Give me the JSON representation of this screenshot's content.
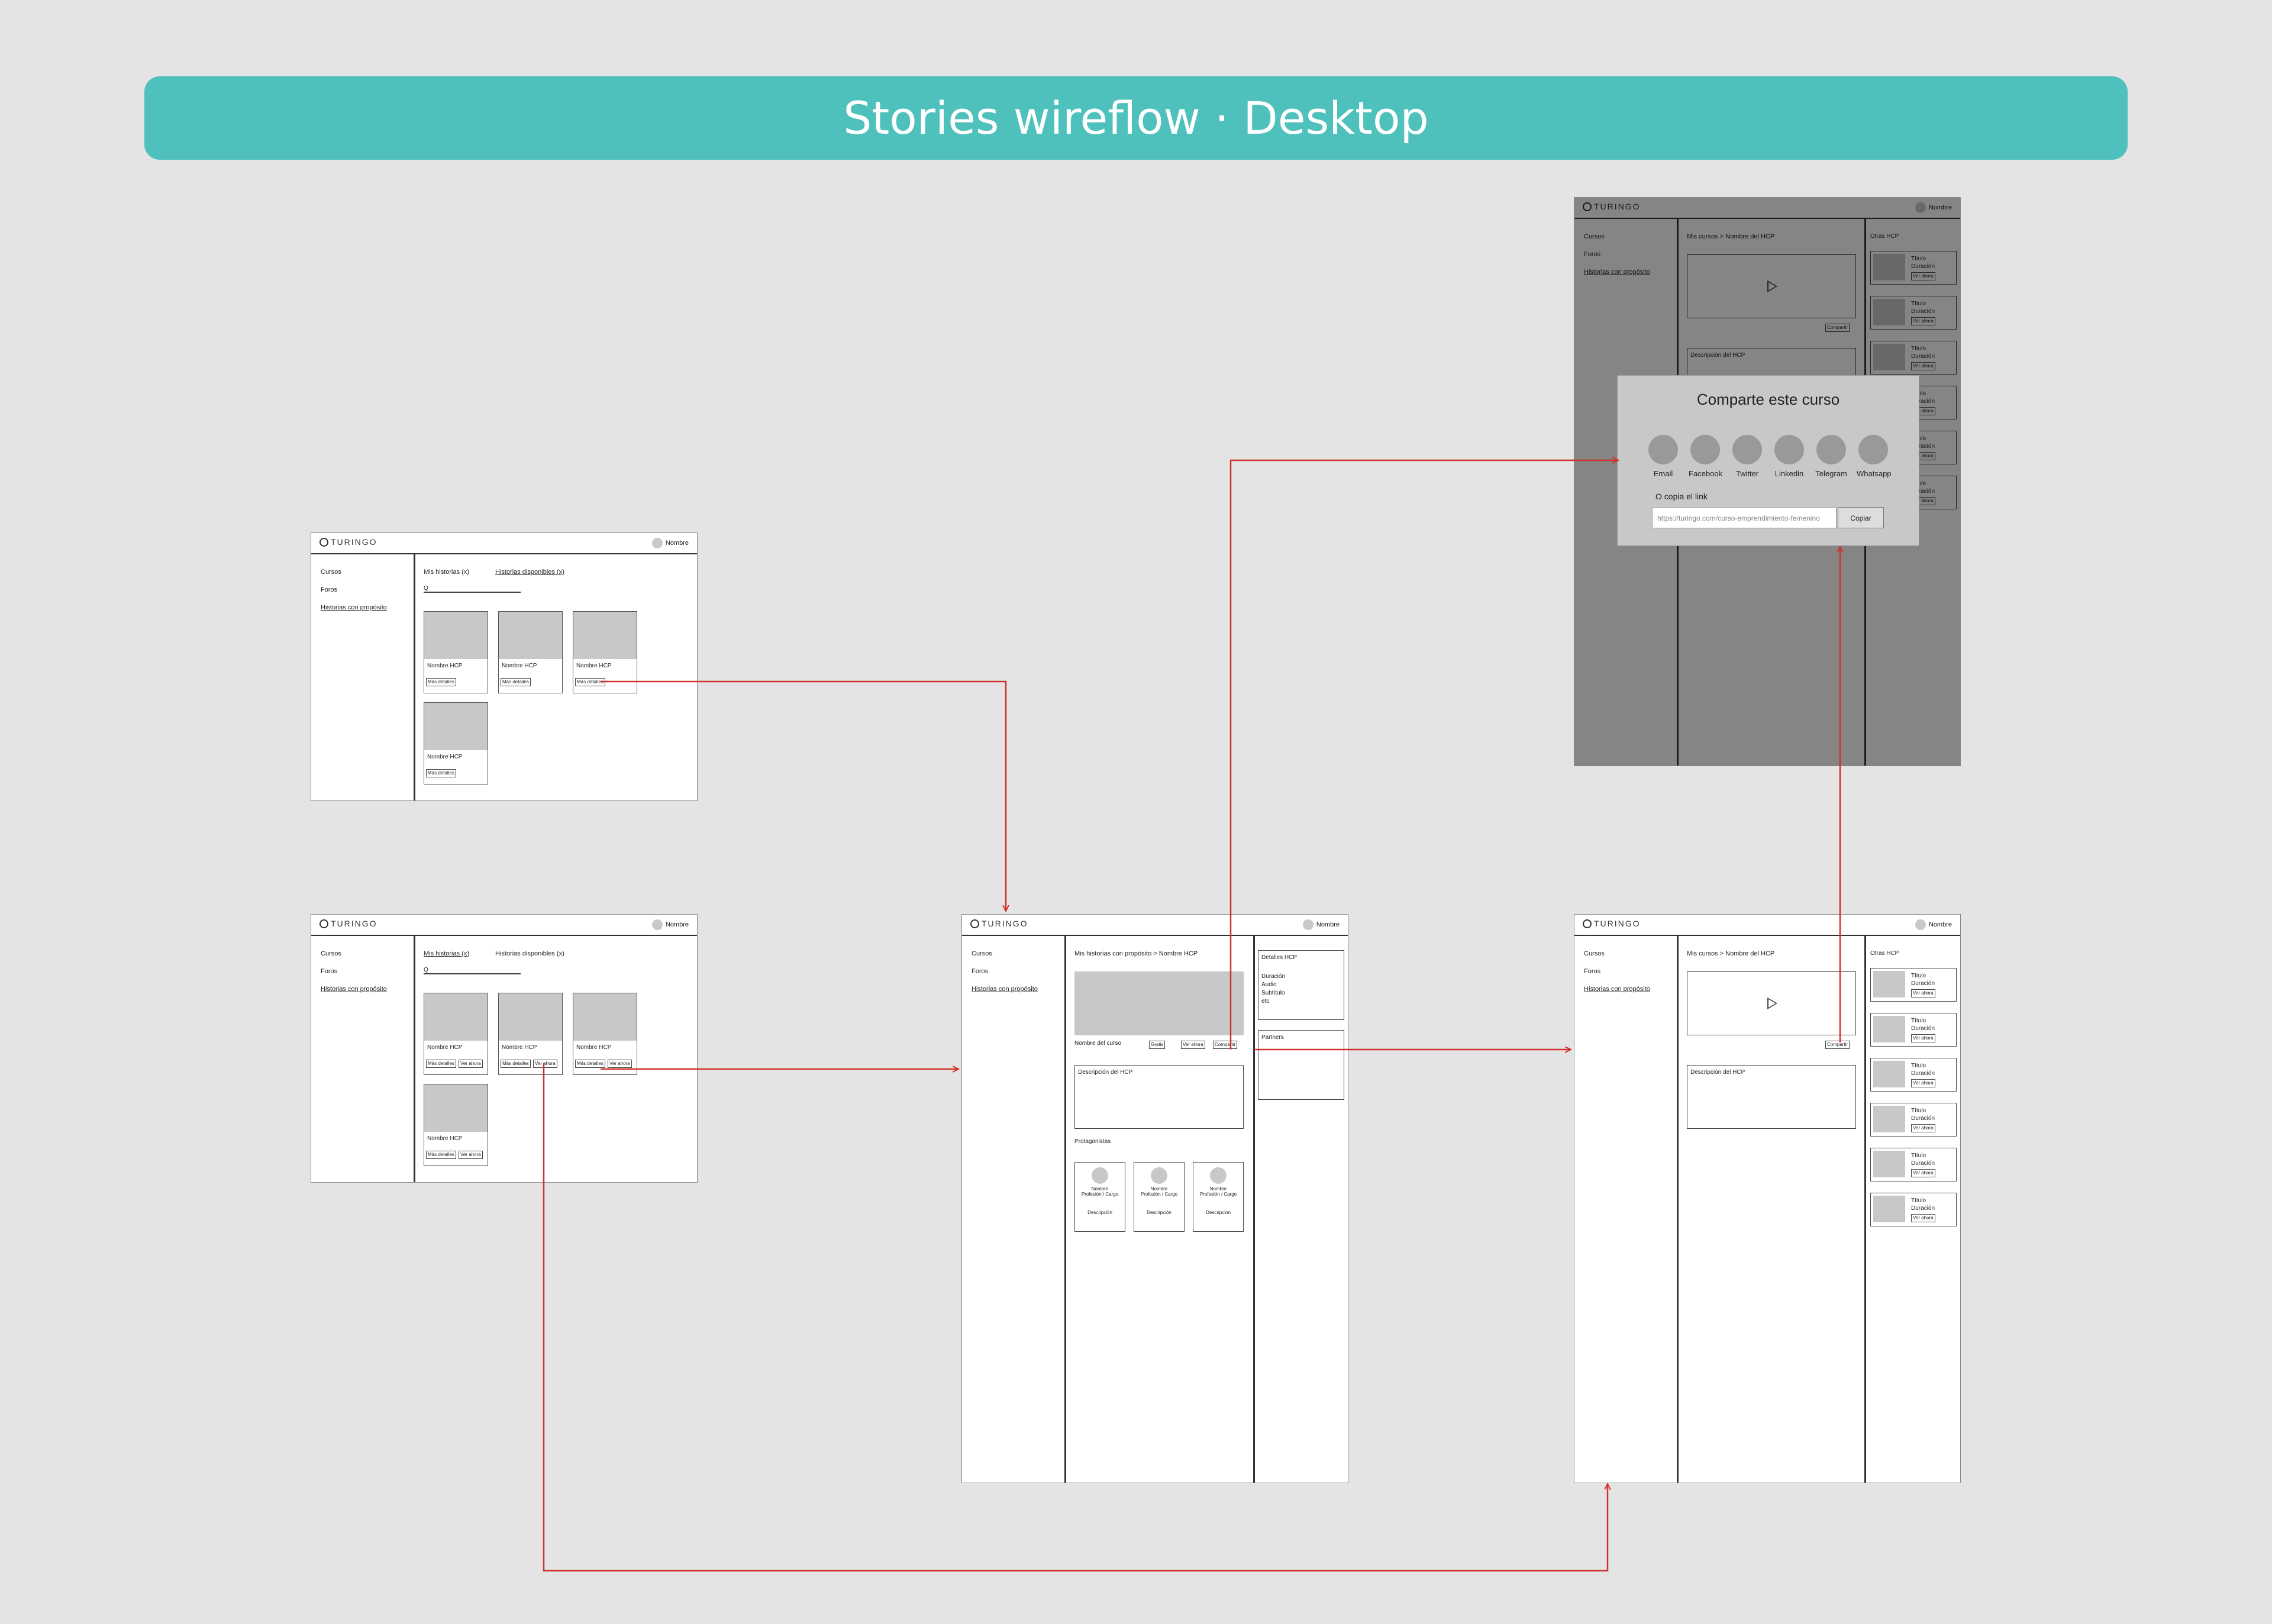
{
  "title": "Stories wireflow · Desktop",
  "brand": "TURINGO",
  "user": "Nombre",
  "nav": [
    "Cursos",
    "Foros",
    "Historias con propósito"
  ],
  "tabs": {
    "mine": "Mis historias (x)",
    "available": "Historias disponibles (x)"
  },
  "search_icon": "Q",
  "card": {
    "name": "Nombre HCP",
    "details": "Más detalles",
    "watch": "Ver ahora"
  },
  "detail": {
    "breadcrumb_root": "Mis historias con propósito",
    "breadcrumb_sep": ">",
    "breadcrumb_leaf": "Nombre HCP",
    "course_name": "Nombre del curso",
    "free": "Gratis",
    "watch": "Ver ahora",
    "share": "Compartir",
    "description": "Descripción del HCP",
    "protagonists": "Protagonistas",
    "person_name": "Nombre",
    "person_role": "Profesión / Cargo",
    "person_desc": "Descripción",
    "details_title": "Detalles HCP",
    "details_items": [
      "Duración",
      "Audio",
      "Subtítulo",
      "etc"
    ],
    "partners": "Partners"
  },
  "player": {
    "breadcrumb_root": "Mis cursos",
    "breadcrumb_sep": ">",
    "breadcrumb_leaf": "Nombre del HCP",
    "share": "Compartir",
    "description": "Descripción del HCP",
    "others": "Otras HCP",
    "item_title": "Título",
    "item_duration": "Duración",
    "item_watch": "Ver ahora"
  },
  "modal": {
    "title": "Comparte este curso",
    "socials": [
      "Email",
      "Facebook",
      "Twitter",
      "Linkedin",
      "Telegram",
      "Whatsapp"
    ],
    "copy_label": "O copia el link",
    "url": "https://turingo.com/curso-emprendimiento-femenino",
    "copy_button": "Copiar"
  },
  "colors": {
    "banner": "#4fc1bc",
    "arrows": "#d0312d",
    "background": "#e4e4e4"
  }
}
